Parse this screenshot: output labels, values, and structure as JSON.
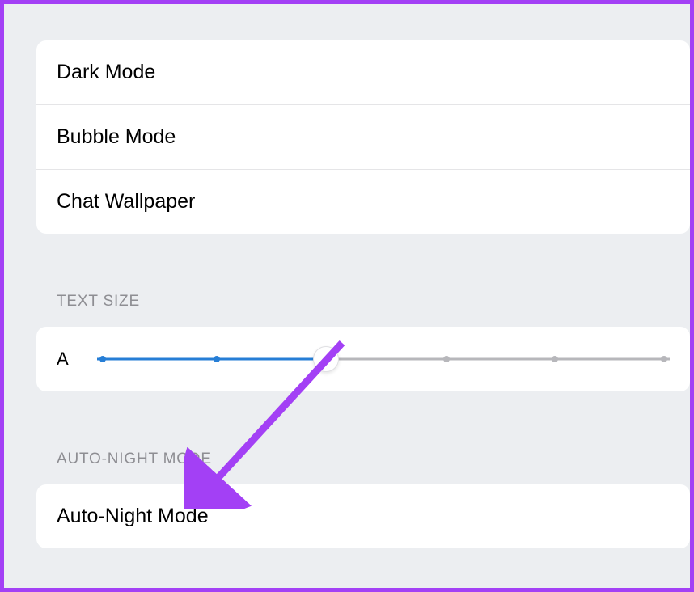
{
  "appearance": {
    "items": [
      {
        "label": "Dark Mode"
      },
      {
        "label": "Bubble Mode"
      },
      {
        "label": "Chat Wallpaper"
      }
    ]
  },
  "textSize": {
    "header": "TEXT SIZE",
    "labelSmall": "A",
    "slider": {
      "value": 2,
      "min": 0,
      "max": 5,
      "tickPositions": [
        1,
        21,
        40,
        61,
        80,
        99
      ],
      "thumbPosition": 40
    }
  },
  "autoNight": {
    "header": "AUTO-NIGHT MODE",
    "items": [
      {
        "label": "Auto-Night Mode"
      }
    ]
  },
  "colors": {
    "accent": "#267ed6",
    "annotation": "#a340f5"
  }
}
